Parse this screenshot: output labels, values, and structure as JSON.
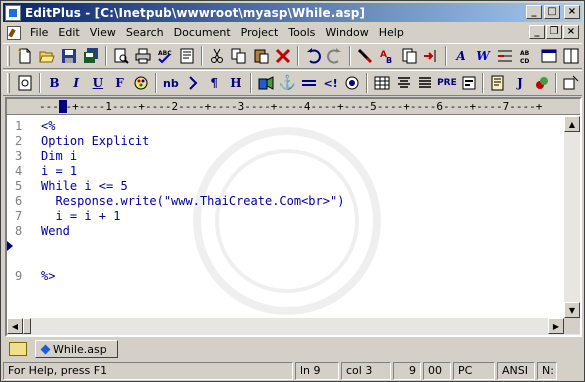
{
  "window": {
    "title": "EditPlus - [C:\\Inetpub\\wwwroot\\myasp\\While.asp]"
  },
  "menu": [
    "File",
    "Edit",
    "View",
    "Search",
    "Document",
    "Project",
    "Tools",
    "Window",
    "Help"
  ],
  "ruler": {
    "text": "-----+----1----+----2----+----3----+----4----+----5----+----6----+----7----+"
  },
  "code": {
    "lines": [
      {
        "num": "1",
        "text": "<%"
      },
      {
        "num": "2",
        "text": "Option Explicit"
      },
      {
        "num": "3",
        "text": "Dim i"
      },
      {
        "num": "4",
        "text": "i = 1"
      },
      {
        "num": "5",
        "text": "While i <= 5"
      },
      {
        "num": "6",
        "text": "  Response.write(\"www.ThaiCreate.Com<br>\")"
      },
      {
        "num": "7",
        "text": "  i = i + 1"
      },
      {
        "num": "8",
        "text": "Wend"
      },
      {
        "num": "9",
        "text": "%>"
      }
    ],
    "current_line": "9"
  },
  "tabs": {
    "file_tab": "While.asp"
  },
  "status": {
    "help": "For Help, press F1",
    "line": "ln 9",
    "col": "col 3",
    "num1": "9",
    "num2": "00",
    "mode": "PC",
    "encoding": "ANSI",
    "extra": "N:"
  },
  "toolbar2_text": {
    "bold": "B",
    "italic": "I",
    "underline": "U",
    "font": "F",
    "nbsp": "nb",
    "pre": "PRE",
    "j": "J"
  },
  "colors": {
    "title_start": "#0a246a",
    "title_end": "#a6caf0",
    "code": "#0000a0",
    "accent_red": "#c00000"
  }
}
